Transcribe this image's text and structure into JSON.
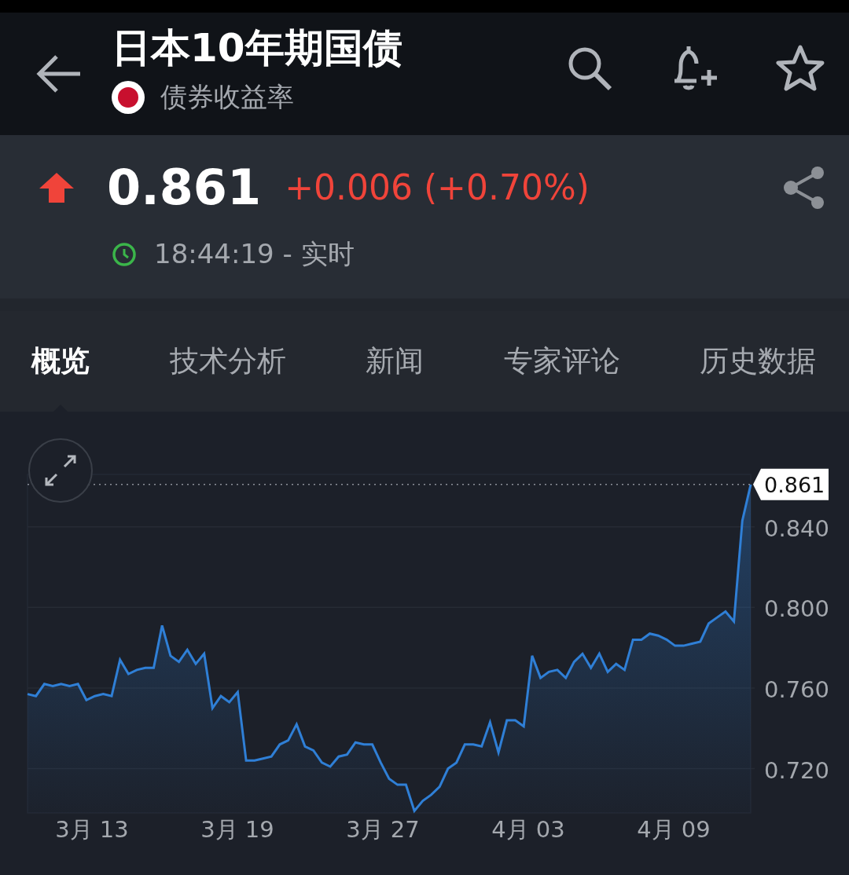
{
  "header": {
    "title": "日本10年期国债",
    "subtitle": "债券收益率"
  },
  "quote": {
    "price": "0.861",
    "change": "+0.006 (+0.70%)",
    "rising": true,
    "time": "18:44:19 - 实时"
  },
  "tabs": [
    {
      "label": "概览",
      "selected": true
    },
    {
      "label": "技术分析",
      "selected": false
    },
    {
      "label": "新闻",
      "selected": false
    },
    {
      "label": "专家评论",
      "selected": false
    },
    {
      "label": "历史数据",
      "selected": false
    }
  ],
  "chart": {
    "x_labels": [
      "3月 13",
      "3月 19",
      "3月 27",
      "4月 03",
      "4月 09"
    ],
    "chart_data": {
      "type": "area",
      "grid": true,
      "ylim": [
        0.698,
        0.866
      ],
      "yticks": [
        {
          "value": 0.72,
          "label": "0.720"
        },
        {
          "value": 0.76,
          "label": "0.760"
        },
        {
          "value": 0.8,
          "label": "0.800"
        },
        {
          "value": 0.84,
          "label": "0.840"
        }
      ],
      "ref_lines": [
        {
          "axis": "y",
          "value": 0.861,
          "label": "0.861"
        }
      ],
      "series": [
        {
          "color": "#2f7fd6",
          "values": [
            0.757,
            0.756,
            0.762,
            0.761,
            0.762,
            0.761,
            0.762,
            0.754,
            0.756,
            0.757,
            0.756,
            0.774,
            0.767,
            0.769,
            0.77,
            0.77,
            0.791,
            0.776,
            0.773,
            0.779,
            0.772,
            0.777,
            0.75,
            0.756,
            0.753,
            0.758,
            0.724,
            0.724,
            0.725,
            0.726,
            0.732,
            0.734,
            0.742,
            0.731,
            0.729,
            0.723,
            0.721,
            0.726,
            0.727,
            0.733,
            0.732,
            0.732,
            0.723,
            0.715,
            0.712,
            0.712,
            0.699,
            0.704,
            0.707,
            0.711,
            0.72,
            0.723,
            0.732,
            0.732,
            0.731,
            0.743,
            0.728,
            0.744,
            0.744,
            0.741,
            0.776,
            0.765,
            0.768,
            0.769,
            0.765,
            0.773,
            0.777,
            0.77,
            0.777,
            0.768,
            0.772,
            0.769,
            0.784,
            0.784,
            0.787,
            0.786,
            0.784,
            0.781,
            0.781,
            0.782,
            0.783,
            0.792,
            0.795,
            0.798,
            0.793,
            0.843,
            0.861
          ]
        }
      ]
    }
  }
}
